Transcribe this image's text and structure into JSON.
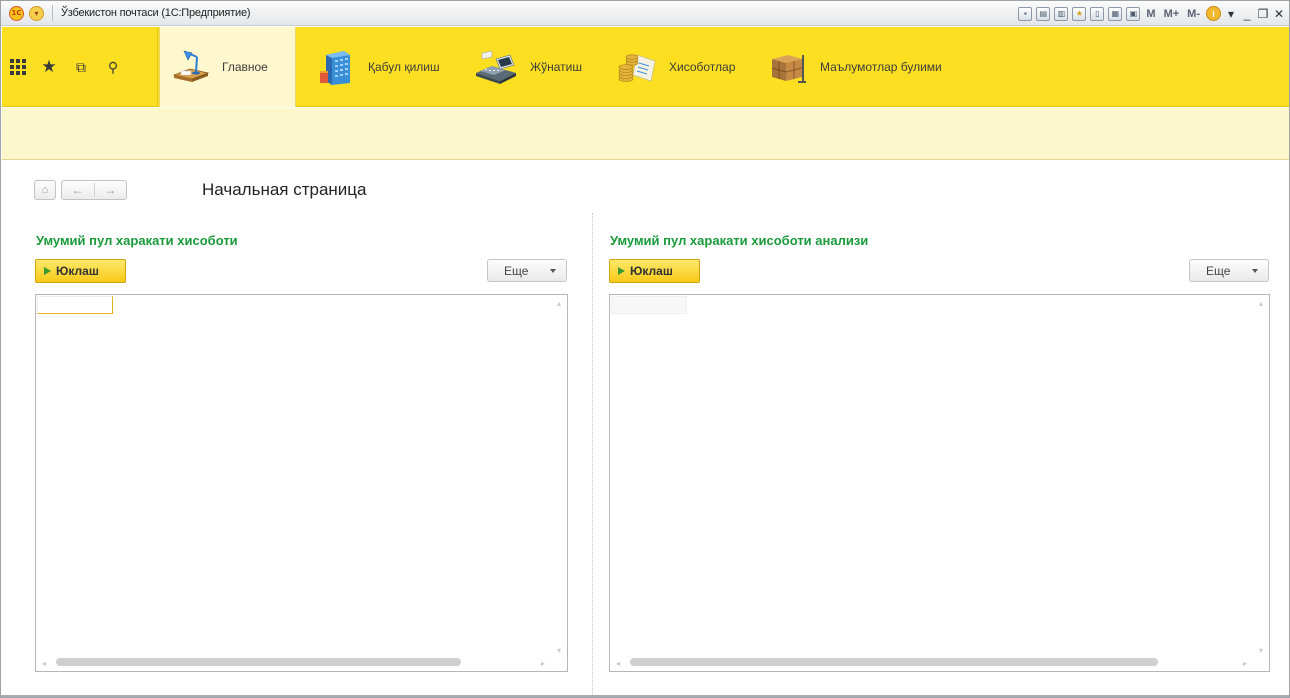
{
  "window": {
    "title": "Ўзбекистон почтаси (1С:Предприятие)",
    "logo_text": "1С",
    "toolbar_mem": [
      "M",
      "M+",
      "M-"
    ],
    "controls": [
      "_",
      "❐",
      "✕"
    ]
  },
  "sections": {
    "items": [
      {
        "label": "Главное",
        "icon": "desk-lamp-icon",
        "active": true
      },
      {
        "label": "Қабул қилиш",
        "icon": "building-icon",
        "active": false
      },
      {
        "label": "Жўнатиш",
        "icon": "cash-register-icon",
        "active": false
      },
      {
        "label": "Хисоботлар",
        "icon": "coins-report-icon",
        "active": false
      },
      {
        "label": "Маълумотлар булими",
        "icon": "boxes-icon",
        "active": false
      }
    ]
  },
  "page": {
    "title": "Начальная страница"
  },
  "left_report": {
    "title": "Умумий пул харакати хисоботи",
    "run_label": "Юклаш",
    "more_label": "Еще"
  },
  "right_report": {
    "title": "Умумий пул харакати хисоботи анализи",
    "run_label": "Юклаш",
    "more_label": "Еще"
  },
  "colors": {
    "section_panel": "#fcdf20",
    "sub_panel": "#fdf8cb",
    "report_title": "#1a9a3a",
    "run_button": "#f7c918"
  }
}
